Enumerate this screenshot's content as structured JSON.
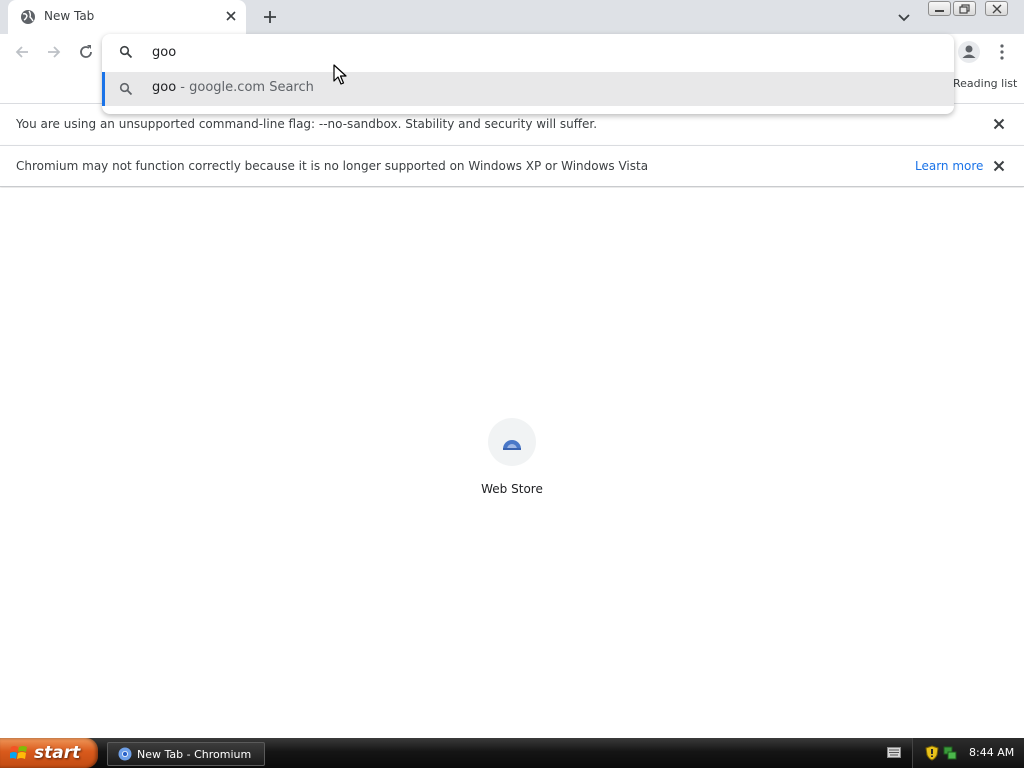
{
  "browser": {
    "tab": {
      "title": "New Tab"
    },
    "toolbar": {
      "reading_list_label": "Reading list"
    }
  },
  "omnibox": {
    "value": "goo",
    "suggestions": [
      {
        "typed": "goo",
        "separator": " - ",
        "description": "google.com Search"
      }
    ]
  },
  "infobars": [
    {
      "message": "You are using an unsupported command-line flag: --no-sandbox. Stability and security will suffer."
    },
    {
      "message": "Chromium may not function correctly because it is no longer supported on Windows XP or Windows Vista",
      "link": "Learn more"
    }
  ],
  "content": {
    "shortcuts": [
      {
        "label": "Web Store",
        "icon": "web-store-icon"
      }
    ]
  },
  "taskbar": {
    "start_label": "start",
    "items": [
      {
        "label": "New Tab - Chromium"
      }
    ],
    "clock": "8:44 AM"
  },
  "colors": {
    "accent": "#1a73e8",
    "tabstrip": "#dee1e6",
    "start_button": "#d95a1c"
  }
}
